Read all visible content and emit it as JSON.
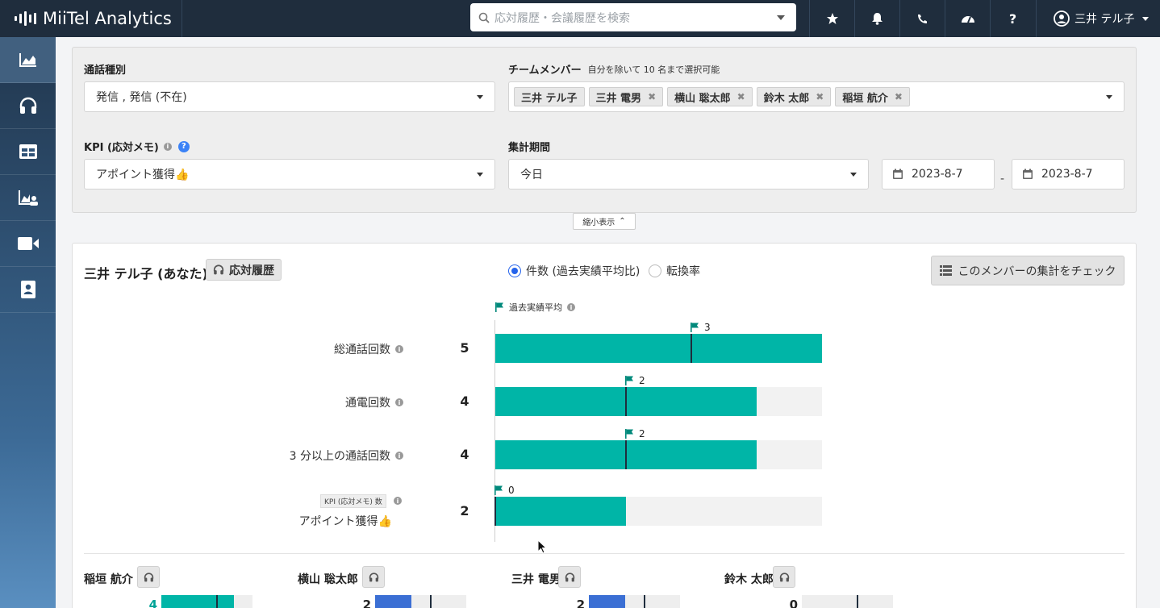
{
  "app": {
    "title": "MiiTel Analytics"
  },
  "search": {
    "placeholder": "応対履歴・会議履歴を検索"
  },
  "user": {
    "name": "三井 テル子"
  },
  "top_icons": [
    "star-icon",
    "bell-icon",
    "phone-icon",
    "gauge-icon",
    "question-icon"
  ],
  "sidebar": {
    "items": [
      "chart-icon",
      "headphones-icon",
      "table-icon",
      "chart-user-icon",
      "video-icon",
      "contact-icon"
    ]
  },
  "filter": {
    "call_type_label": "通話種別",
    "call_type_value": "発信 , 発信 (不在)",
    "team_label": "チームメンバー",
    "team_note": "自分を除いて 10 名まで選択可能",
    "team_members": [
      "三井 テル子",
      "三井 電男",
      "横山 聡太郎",
      "鈴木 太郎",
      "稲垣 航介"
    ],
    "kpi_label": "KPI (応対メモ)",
    "kpi_value": "アポイント獲得👍",
    "period_label": "集計期間",
    "period_value": "今日",
    "date_from": "2023-8-7",
    "date_sep": "-",
    "date_to": "2023-8-7",
    "collapse_label": "縮小表示"
  },
  "card": {
    "member_title": "三井 テル子 (あなた)",
    "history_btn": "応対履歴",
    "radio_count": "件数 (過去実績平均比)",
    "radio_rate": "転換率",
    "check_btn": "このメンバーの集計をチェック",
    "legend": "過去実績平均",
    "kpi_mini": "KPI (応対メモ) 数",
    "max": 5,
    "rows": [
      {
        "label": "総通話回数",
        "value": 5,
        "avg": 3
      },
      {
        "label": "通電回数",
        "value": 4,
        "avg": 2
      },
      {
        "label": "3 分以上の通話回数",
        "value": 4,
        "avg": 2
      },
      {
        "label": "アポイント獲得👍",
        "value": 2,
        "avg": 0
      }
    ]
  },
  "members": [
    {
      "name": "稲垣 航介",
      "value": "4",
      "fill_frac": 0.8,
      "avg_frac": 0.6,
      "color": "#00b5a7"
    },
    {
      "name": "横山 聡太郎",
      "value": "2",
      "fill_frac": 0.4,
      "avg_frac": 0.6,
      "color": "#3b6fd4"
    },
    {
      "name": "三井 電男",
      "value": "2",
      "fill_frac": 0.4,
      "avg_frac": 0.6,
      "color": "#3b6fd4"
    },
    {
      "name": "鈴木 太郎",
      "value": "0",
      "fill_frac": 0.0,
      "avg_frac": 0.6,
      "color": "#3b6fd4"
    }
  ],
  "colors": {
    "topbar": "#1f2d3d",
    "bar": "#00b5a7",
    "bar_low": "#3b6fd4",
    "accent": "#2563eb"
  }
}
